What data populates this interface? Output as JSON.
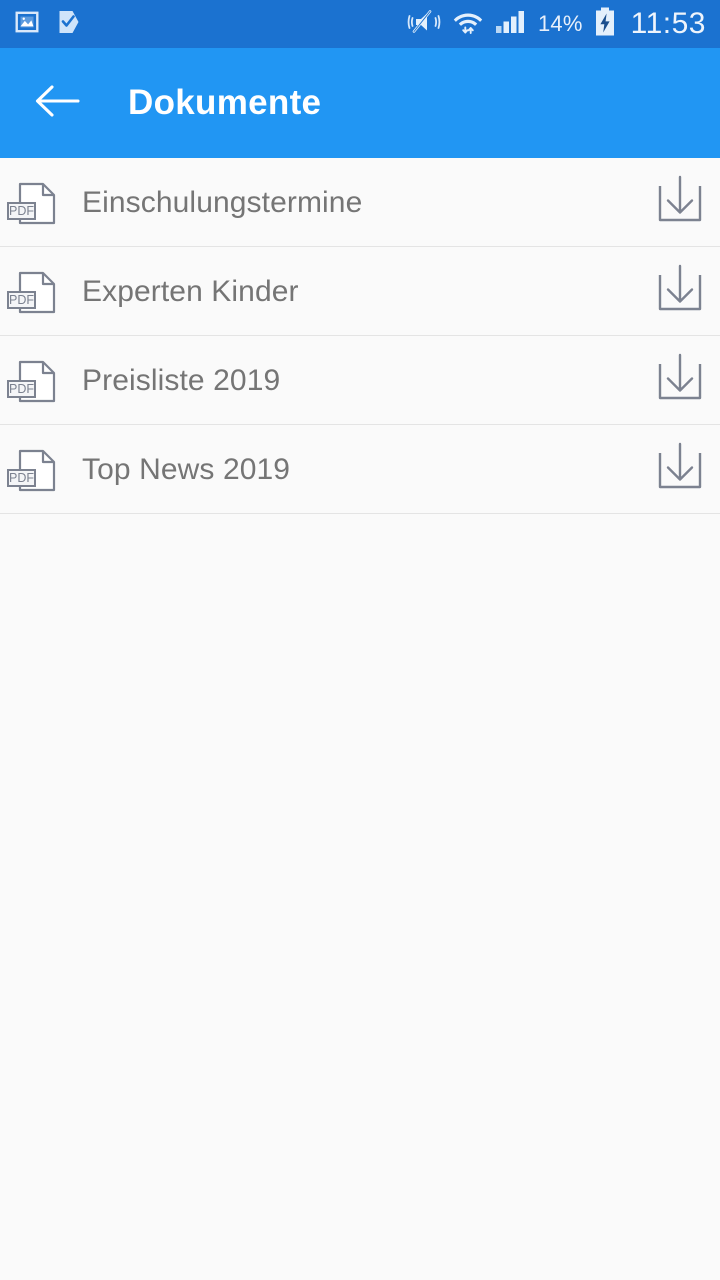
{
  "status_bar": {
    "background_color": "#1b72d0",
    "icons": [
      {
        "name": "gallery-icon",
        "label": "Gallery"
      },
      {
        "name": "checkmark-flag-icon",
        "label": "Tasks"
      },
      {
        "name": "vibrate-mute-icon",
        "label": "Sound off / vibrate"
      },
      {
        "name": "wifi-transfer-icon",
        "label": "Wi-Fi with data transfer"
      },
      {
        "name": "cellular-signal-icon",
        "label": "Mobile signal"
      }
    ],
    "battery_percent": "14%",
    "battery_state": "charging",
    "clock": "11:53"
  },
  "app_bar": {
    "background_color": "#2196f3",
    "back_label": "Back",
    "title": "Dokumente"
  },
  "documents": {
    "accent_color": "#2196f3",
    "file_type_badge": "PDF",
    "download_label": "Download",
    "items": [
      {
        "name": "Einschulungstermine",
        "type": "PDF"
      },
      {
        "name": "Experten Kinder",
        "type": "PDF"
      },
      {
        "name": "Preisliste 2019",
        "type": "PDF"
      },
      {
        "name": "Top News 2019",
        "type": "PDF"
      }
    ]
  }
}
